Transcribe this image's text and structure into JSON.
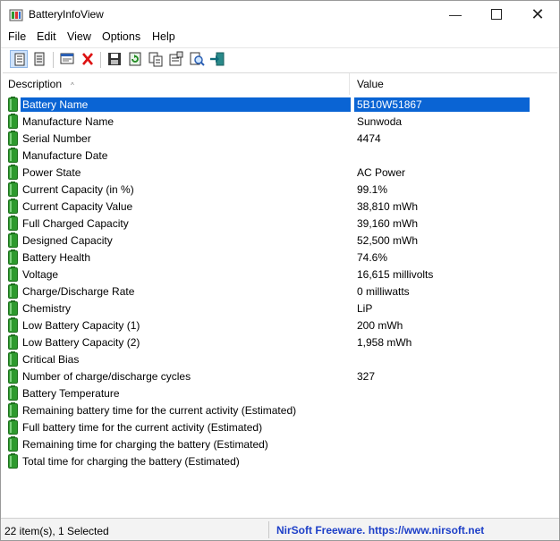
{
  "window": {
    "title": "BatteryInfoView",
    "minimize_glyph": "—",
    "close_glyph": "✕"
  },
  "menu": [
    "File",
    "Edit",
    "View",
    "Options",
    "Help"
  ],
  "toolbar": [
    {
      "name": "html-report-button",
      "icon": "document-lines-icon"
    },
    {
      "name": "log-view-button",
      "icon": "clipboard-icon"
    },
    {
      "name": "properties-window-button",
      "icon": "window-icon"
    },
    {
      "name": "delete-button",
      "icon": "red-x-icon"
    },
    {
      "name": "save-button",
      "icon": "floppy-disk-icon"
    },
    {
      "name": "refresh-button",
      "icon": "refresh-icon"
    },
    {
      "name": "copy-button",
      "icon": "copy-icon"
    },
    {
      "name": "properties-button",
      "icon": "properties-icon"
    },
    {
      "name": "find-button",
      "icon": "magnifier-icon"
    },
    {
      "name": "exit-button",
      "icon": "exit-door-icon"
    }
  ],
  "columns": {
    "description": "Description",
    "value": "Value",
    "sort_glyph": "^"
  },
  "rows": [
    {
      "description": "Battery Name",
      "value": "5B10W51867",
      "selected": true
    },
    {
      "description": "Manufacture Name",
      "value": "Sunwoda"
    },
    {
      "description": "Serial Number",
      "value": " 4474"
    },
    {
      "description": "Manufacture Date",
      "value": ""
    },
    {
      "description": "Power State",
      "value": "AC Power"
    },
    {
      "description": "Current Capacity (in %)",
      "value": "99.1%"
    },
    {
      "description": "Current Capacity Value",
      "value": "38,810 mWh"
    },
    {
      "description": "Full Charged Capacity",
      "value": "39,160 mWh"
    },
    {
      "description": "Designed Capacity",
      "value": "52,500 mWh"
    },
    {
      "description": "Battery Health",
      "value": "74.6%"
    },
    {
      "description": "Voltage",
      "value": "16,615 millivolts"
    },
    {
      "description": "Charge/Discharge Rate",
      "value": "0 milliwatts"
    },
    {
      "description": "Chemistry",
      "value": "LiP"
    },
    {
      "description": "Low Battery Capacity (1)",
      "value": "200 mWh"
    },
    {
      "description": "Low Battery Capacity (2)",
      "value": "1,958 mWh"
    },
    {
      "description": "Critical Bias",
      "value": ""
    },
    {
      "description": "Number of charge/discharge cycles",
      "value": "327"
    },
    {
      "description": "Battery Temperature",
      "value": ""
    },
    {
      "description": "Remaining battery time for the current activity (Estimated)",
      "value": ""
    },
    {
      "description": "Full battery time for the current activity (Estimated)",
      "value": ""
    },
    {
      "description": "Remaining time for charging the battery (Estimated)",
      "value": ""
    },
    {
      "description": "Total  time for charging the battery (Estimated)",
      "value": ""
    }
  ],
  "status": {
    "items": "22 item(s), 1 Selected",
    "credit": "NirSoft Freeware. https://www.nirsoft.net"
  },
  "colors": {
    "selection": "#0a64d4",
    "battery_green": "#2e9a2e",
    "credit_link": "#1e40c8"
  }
}
